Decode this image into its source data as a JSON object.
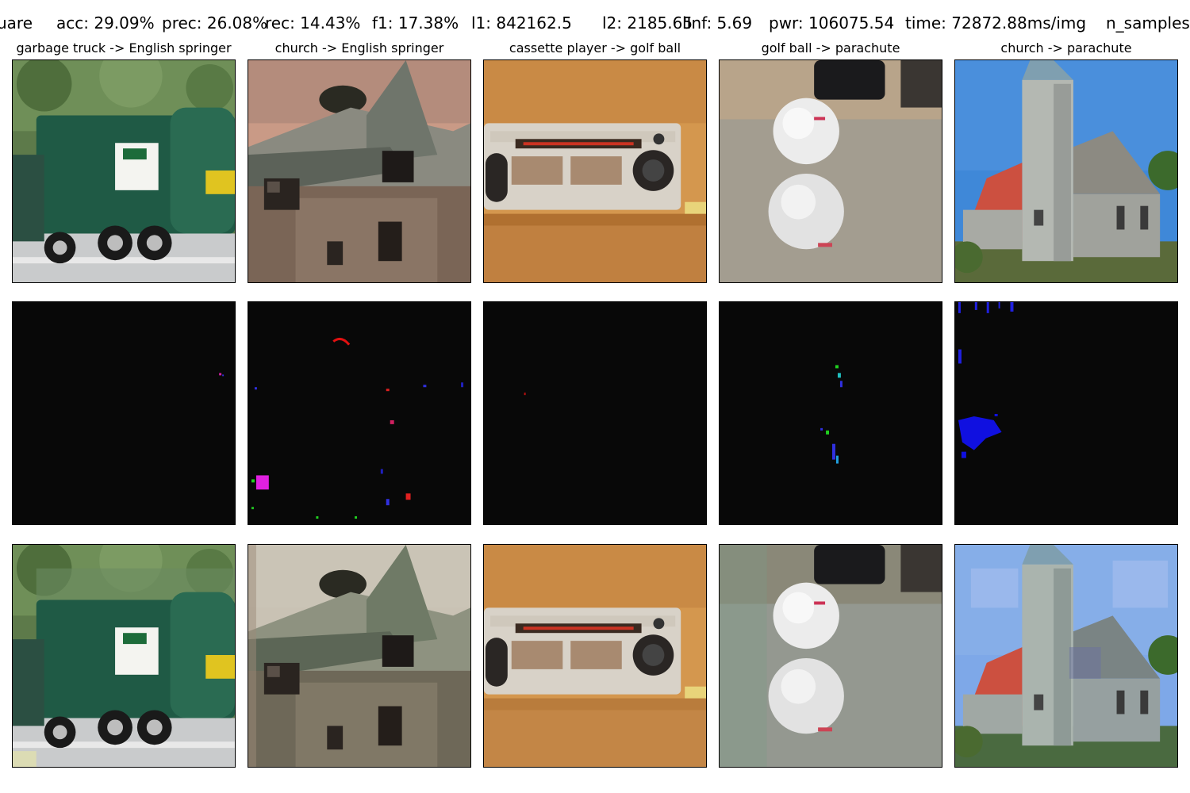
{
  "header": {
    "method": "uare",
    "acc": "acc: 29.09%",
    "prec": "prec: 26.08%",
    "rec": "rec: 14.43%",
    "f1": "f1: 17.38%",
    "l1": "l1: 842162.5",
    "l2": "l2: 2185.65",
    "linf": "lInf: 5.69",
    "pwr": "pwr: 106075.54",
    "time": "time: 72872.88ms/img",
    "n_samples": "n_samples:"
  },
  "columns": [
    {
      "title": "garbage truck -> English springer",
      "subject": "garbage-truck"
    },
    {
      "title": "church -> English springer",
      "subject": "stone-house"
    },
    {
      "title": "cassette player -> golf ball",
      "subject": "cassette-player"
    },
    {
      "title": "golf ball -> parachute",
      "subject": "golf-balls"
    },
    {
      "title": "church -> parachute",
      "subject": "church"
    }
  ],
  "rows": [
    "original",
    "perturbation",
    "adversarial"
  ]
}
